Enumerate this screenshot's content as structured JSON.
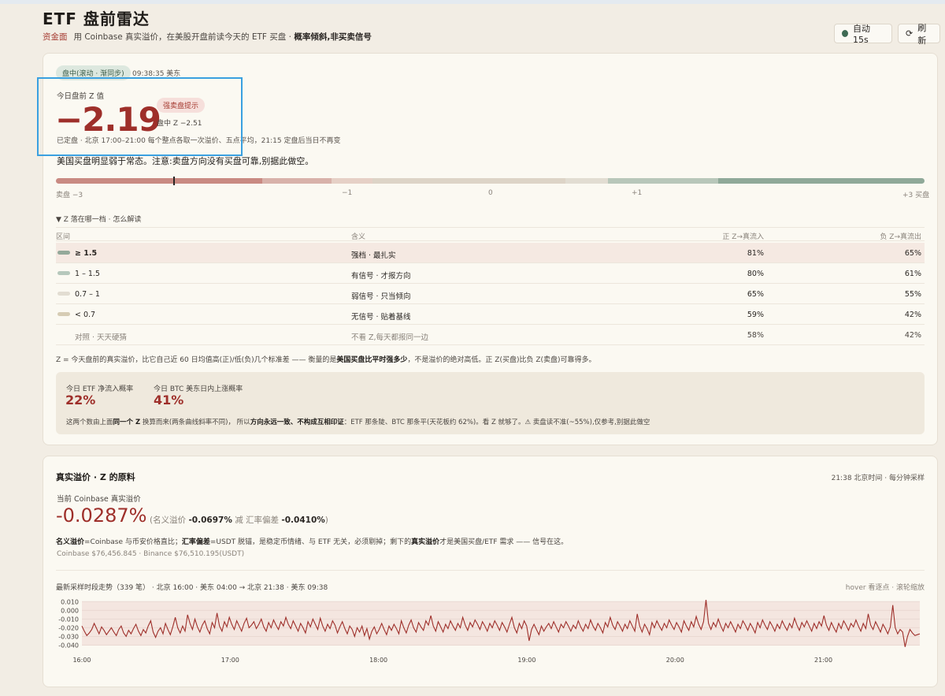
{
  "header": {
    "title": "ETF 盘前雷达",
    "tag": "资金面",
    "subtitle": "用 Coinbase 真实溢价，在美股开盘前读今天的 ETF 买盘 ·",
    "subtitle_bold": "概率倾斜,非买卖信号",
    "auto_label": "自动 15s",
    "refresh_label": "刷新"
  },
  "status": {
    "pill": "盘中(滚动 · 渐同步)",
    "time": "09:38:35 美东"
  },
  "zscore": {
    "label": "今日盘前 Z 值",
    "value": "−2.19",
    "badge": "强卖盘提示",
    "intraday": "盘中 Z −2.51",
    "settled": "已定盘 · 北京 17:00–21:00 每个整点各取一次溢价、五点平均，21:15 定盘后当日不再变",
    "comment": "美国买盘明显弱于常态。注意:卖盘方向没有买盘可靠,别据此做空。"
  },
  "scale": {
    "labels": [
      "卖盘 −3",
      "−1",
      "0",
      "+1",
      "+3 买盘"
    ],
    "colors": [
      "#c98a82",
      "#c98a82",
      "#d8b2aa",
      "#e6d0c6",
      "#ddd4c7",
      "#e2ddd2",
      "#b8c7ba",
      "#8fa999"
    ],
    "marker": -2.19
  },
  "table": {
    "toggle": "▼ Z 落在哪一档 · 怎么解读",
    "headers": [
      "区间",
      "含义",
      "正 Z→真流入",
      "负 Z→真流出"
    ],
    "rows": [
      {
        "range": "≥ 1.5",
        "meaning": "强档 · 最扎实",
        "pos": "81%",
        "neg": "65%",
        "color": "#94a99a"
      },
      {
        "range": "1 – 1.5",
        "meaning": "有信号 · 才报方向",
        "pos": "80%",
        "neg": "61%",
        "color": "#b6c8bc"
      },
      {
        "range": "0.7 – 1",
        "meaning": "弱信号 · 只当倾向",
        "pos": "65%",
        "neg": "55%",
        "color": "#e2ddd2"
      },
      {
        "range": "< 0.7",
        "meaning": "无信号 · 贴着基线",
        "pos": "59%",
        "neg": "42%",
        "color": "#d6ccb4"
      },
      {
        "range": "对照 · 天天硬猜",
        "meaning": "不看 Z,每天都报同一边",
        "pos": "58%",
        "neg": "42%",
        "color": ""
      }
    ]
  },
  "explain": {
    "part1": "Z = 今天盘前的真实溢价，比它自己近 60 日均值高(正)/低(负)几个标准差 —— 衡量的是",
    "bold": "美国买盘比平时强多少",
    "part2": "，不是溢价的绝对高低。正 Z(买盘)比负 Z(卖盘)可靠得多。"
  },
  "probabilities": {
    "etf_label": "今日 ETF 净流入概率",
    "etf_value": "22%",
    "btc_label": "今日 BTC 美东日内上涨概率",
    "btc_value": "41%",
    "note_a": "这两个数由上面",
    "note_b": "同一个 Z",
    "note_c": " 换算而来(两条曲线斜率不同)， 所以",
    "note_d": "方向永远一致、不构成互相印证",
    "note_e": "：ETF 那条陡、BTC 那条平(天花板约 62%)。看 Z 就够了。⚠ 卖盘读不准(~55%),仅参考,别据此做空"
  },
  "premium": {
    "title": "真实溢价 · Z 的原料",
    "meta": "21:38 北京时间 · 每分钟采样",
    "current_label": "当前 Coinbase 真实溢价",
    "value": "-0.0287%",
    "nominal_label": "(名义溢价",
    "nominal_value": "-0.0697%",
    "minus_label": "减 汇率偏差",
    "fx_value": "-0.0410%",
    "close_paren": ")",
    "desc_b1": "名义溢价",
    "desc_t1": "=Coinbase 与币安价格直比；",
    "desc_b2": "汇率偏差",
    "desc_t2": "=USDT 脱锚，是稳定币情绪、与 ETF 无关，必须剔掉；剩下的",
    "desc_b3": "真实溢价",
    "desc_t3": "才是美国买盘/ETF 需求 —— 信号在这。",
    "prices": "Coinbase $76,456.845 · Binance $76,510.195(USDT)",
    "trend_label": "最新采样时段走势（339 笔） · 北京 16:00 · 美东 04:00 → 北京 21:38 · 美东 09:38",
    "trend_hint": "hover 看逐点 · 滚轮缩放"
  },
  "chart_data": {
    "type": "line",
    "y_ticks": [
      "0.010",
      "0.000",
      "-0.010",
      "-0.020",
      "-0.030",
      "-0.040"
    ],
    "ylim": [
      -0.045,
      0.013
    ],
    "x_ticks": [
      "16:00",
      "17:00",
      "18:00",
      "19:00",
      "20:00",
      "21:00"
    ],
    "x_tick_minutes": [
      0,
      60,
      120,
      180,
      240,
      300
    ],
    "x_range_minutes": [
      0,
      339
    ],
    "series": [
      {
        "color": "#9e2f2a",
        "values": [
          -0.018,
          -0.024,
          -0.029,
          -0.026,
          -0.022,
          -0.015,
          -0.021,
          -0.027,
          -0.019,
          -0.023,
          -0.028,
          -0.024,
          -0.02,
          -0.025,
          -0.029,
          -0.022,
          -0.018,
          -0.026,
          -0.03,
          -0.023,
          -0.027,
          -0.021,
          -0.016,
          -0.024,
          -0.029,
          -0.022,
          -0.026,
          -0.018,
          -0.012,
          -0.025,
          -0.031,
          -0.024,
          -0.02,
          -0.027,
          -0.015,
          -0.022,
          -0.028,
          -0.019,
          -0.008,
          -0.02,
          -0.026,
          -0.018,
          -0.024,
          -0.005,
          -0.015,
          -0.022,
          -0.01,
          -0.019,
          -0.025,
          -0.017,
          -0.012,
          -0.021,
          -0.027,
          -0.014,
          -0.02,
          -0.003,
          -0.018,
          -0.024,
          -0.013,
          -0.019,
          -0.008,
          -0.016,
          -0.022,
          -0.012,
          -0.018,
          -0.024,
          -0.015,
          -0.009,
          -0.02,
          -0.017,
          -0.013,
          -0.021,
          -0.016,
          -0.01,
          -0.019,
          -0.024,
          -0.014,
          -0.02,
          -0.011,
          -0.017,
          -0.022,
          -0.013,
          -0.018,
          -0.008,
          -0.016,
          -0.021,
          -0.012,
          -0.018,
          -0.024,
          -0.015,
          -0.02,
          -0.026,
          -0.013,
          -0.019,
          -0.01,
          -0.016,
          -0.022,
          -0.009,
          -0.018,
          -0.024,
          -0.016,
          -0.021,
          -0.012,
          -0.017,
          -0.026,
          -0.019,
          -0.013,
          -0.021,
          -0.027,
          -0.018,
          -0.022,
          -0.03,
          -0.02,
          -0.025,
          -0.018,
          -0.029,
          -0.021,
          -0.033,
          -0.024,
          -0.019,
          -0.027,
          -0.022,
          -0.015,
          -0.022,
          -0.028,
          -0.018,
          -0.023,
          -0.016,
          -0.021,
          -0.027,
          -0.012,
          -0.02,
          -0.026,
          -0.017,
          -0.011,
          -0.02,
          -0.025,
          -0.014,
          -0.019,
          -0.023,
          -0.012,
          -0.017,
          -0.006,
          -0.018,
          -0.024,
          -0.013,
          -0.019,
          -0.025,
          -0.016,
          -0.021,
          -0.012,
          -0.018,
          -0.023,
          -0.015,
          -0.02,
          -0.008,
          -0.017,
          -0.023,
          -0.014,
          -0.019,
          -0.011,
          -0.016,
          -0.022,
          -0.013,
          -0.018,
          -0.024,
          -0.015,
          -0.02,
          -0.012,
          -0.017,
          -0.023,
          -0.014,
          -0.019,
          -0.025,
          -0.016,
          -0.008,
          -0.02,
          -0.026,
          -0.015,
          -0.021,
          -0.012,
          -0.018,
          -0.035,
          -0.022,
          -0.016,
          -0.022,
          -0.028,
          -0.018,
          -0.024,
          -0.019,
          -0.015,
          -0.021,
          -0.013,
          -0.019,
          -0.025,
          -0.016,
          -0.02,
          -0.013,
          -0.018,
          -0.024,
          -0.017,
          -0.021,
          -0.012,
          -0.019,
          -0.024,
          -0.016,
          -0.021,
          -0.011,
          -0.018,
          -0.023,
          -0.015,
          -0.02,
          -0.026,
          -0.014,
          -0.019,
          -0.008,
          -0.017,
          -0.022,
          -0.013,
          -0.018,
          -0.024,
          -0.016,
          -0.021,
          -0.012,
          -0.018,
          -0.024,
          -0.004,
          -0.018,
          -0.025,
          -0.016,
          -0.021,
          -0.028,
          -0.014,
          -0.02,
          -0.012,
          -0.018,
          -0.023,
          -0.015,
          -0.02,
          -0.011,
          -0.017,
          -0.022,
          -0.014,
          -0.019,
          -0.025,
          -0.012,
          -0.018,
          -0.023,
          -0.013,
          -0.019,
          -0.007,
          -0.016,
          -0.022,
          -0.013,
          0.012,
          -0.015,
          -0.022,
          -0.014,
          -0.019,
          -0.01,
          -0.018,
          -0.024,
          -0.015,
          -0.02,
          -0.013,
          -0.019,
          -0.025,
          -0.016,
          -0.021,
          -0.012,
          -0.017,
          -0.023,
          -0.015,
          -0.02,
          -0.026,
          -0.014,
          -0.02,
          -0.011,
          -0.017,
          -0.022,
          -0.013,
          -0.018,
          -0.024,
          -0.016,
          -0.021,
          -0.012,
          -0.018,
          -0.023,
          -0.015,
          -0.02,
          -0.009,
          -0.017,
          -0.023,
          -0.014,
          -0.019,
          -0.012,
          -0.018,
          -0.024,
          -0.015,
          -0.021,
          -0.013,
          -0.018,
          -0.006,
          -0.017,
          -0.023,
          -0.014,
          -0.02,
          -0.025,
          -0.015,
          -0.021,
          -0.012,
          -0.017,
          -0.023,
          -0.015,
          -0.019,
          -0.011,
          -0.018,
          -0.024,
          -0.015,
          -0.021,
          -0.004,
          -0.017,
          -0.022,
          -0.013,
          -0.019,
          -0.025,
          -0.016,
          -0.021,
          -0.027,
          -0.019,
          0.006,
          -0.02,
          -0.027,
          -0.022,
          -0.025,
          -0.042,
          -0.03,
          -0.022,
          -0.026,
          -0.029,
          -0.028,
          -0.027
        ]
      }
    ]
  }
}
